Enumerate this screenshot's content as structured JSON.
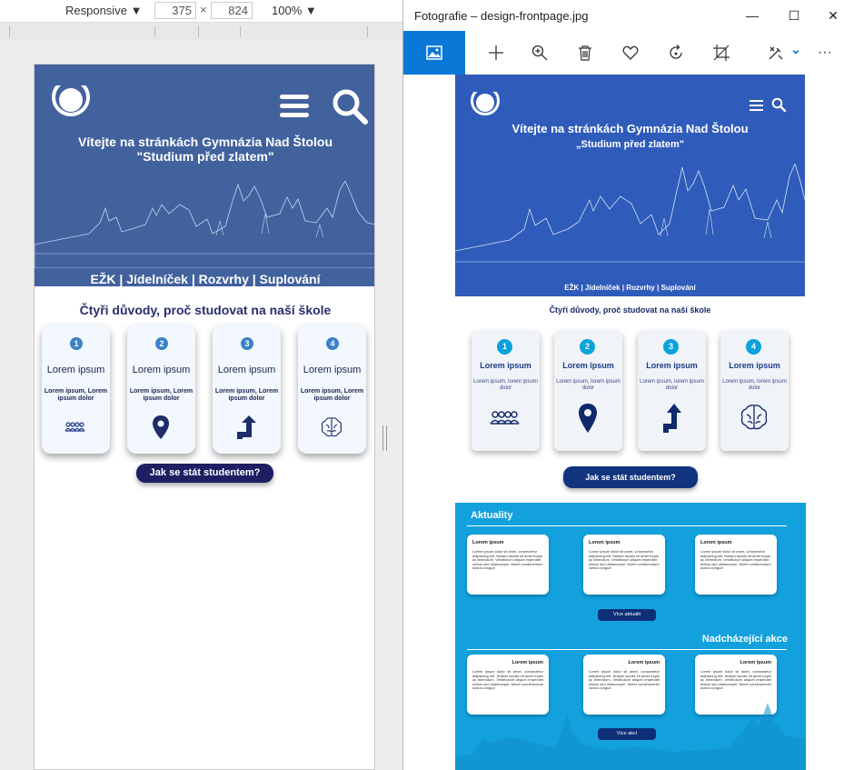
{
  "devtools": {
    "device": "Responsive",
    "width": "375",
    "times": "×",
    "height": "824",
    "zoom": "100%"
  },
  "left_site": {
    "welcome": "Vítejte na stránkách Gymnázia Nad Štolou",
    "motto": "\"Studium před zlatem\"",
    "links": "EŽK | Jídelníček | Rozvrhy | Suplování",
    "reasons_title": "Čtyři důvody, proč studovat na naší škole",
    "cards": [
      {
        "num": "1",
        "title": "Lorem ipsum",
        "desc": "Lorem ipsum, Lorem ipsum dolor"
      },
      {
        "num": "2",
        "title": "Lorem ipsum",
        "desc": "Lorem ipsum, Lorem ipsum dolor"
      },
      {
        "num": "3",
        "title": "Lorem ipsum",
        "desc": "Lorem ipsum, Lorem ipsum dolor"
      },
      {
        "num": "4",
        "title": "Lorem ipsum",
        "desc": "Lorem ipsum, Lorem ipsum dolor"
      }
    ],
    "cta": "Jak se stát studentem?"
  },
  "photos": {
    "title": "Fotografie – design-frontpage.jpg",
    "minimize": "—",
    "maximize": "☐",
    "close": "✕",
    "more": "···",
    "chevron": "⌄"
  },
  "right_site": {
    "welcome": "Vítejte na stránkách Gymnázia Nad Štolou",
    "motto": "„Studium před zlatem\"",
    "links": "EŽK | Jídelníček | Rozvrhy | Suplování",
    "reasons_title": "Čtyři důvody, proč studovat na naší škole",
    "cards": [
      {
        "num": "1",
        "title": "Lorem ipsum",
        "desc": "Lorem ipsum, lorem ipsum dolor"
      },
      {
        "num": "2",
        "title": "Lorem ipsum",
        "desc": "Lorem ipsum, lorem ipsum dolor"
      },
      {
        "num": "3",
        "title": "Lorem ipsum",
        "desc": "Lorem ipsum, lorem ipsum dolor"
      },
      {
        "num": "4",
        "title": "Lorem ipsum",
        "desc": "Lorem ipsum, lorem ipsum dolor"
      }
    ],
    "cta": "Jak se stát studentem?",
    "news_title": "Aktuality",
    "news": [
      {
        "title": "Lorem ipsum",
        "body": "Lorem ipsum dolor sit amet, consectetur adipiscing elit. Nullam iaculis sit amet turpis ac bibendum. Vestibulum aliquet imperdiet metus sed ullamcorper. Morbi condimentum luctus congue."
      },
      {
        "title": "Lorem ipsum",
        "body": "Lorem ipsum dolor sit amet, consectetur adipiscing elit. Nullam iaculis sit amet turpis ac bibendum. Vestibulum aliquet imperdiet metus sed ullamcorper. Morbi condimentum luctus congue."
      },
      {
        "title": "Lorem ipsum",
        "body": "Lorem ipsum dolor sit amet, consectetur adipiscing elit. Nullam iaculis sit amet turpis ac bibendum. Vestibulum aliquet imperdiet metus sed ullamcorper. Morbi condimentum luctus congue."
      }
    ],
    "news_button": "Více aktualit",
    "events_title": "Nadcházející akce",
    "events": [
      {
        "title": "Lorem ipsum",
        "body": "Lorem ipsum dolor sit amet, consectetur adipiscing elit. Nullam iaculis sit amet turpis ac bibendum. Vestibulum aliquet imperdiet metus sed ullamcorper. Morbi condimentum luctus congue."
      },
      {
        "title": "Lorem ipsum",
        "body": "Lorem ipsum dolor sit amet, consectetur adipiscing elit. Nullam iaculis sit amet turpis ac bibendum. Vestibulum aliquet imperdiet metus sed ullamcorper. Morbi condimentum luctus congue."
      },
      {
        "title": "Lorem ipsum",
        "body": "Lorem ipsum dolor sit amet, consectetur adipiscing elit. Nullam iaculis sit amet turpis ac bibendum. Vestibulum aliquet imperdiet metus sed ullamcorper. Morbi condimentum luctus congue."
      }
    ],
    "events_button": "Více akcí"
  },
  "colors": {
    "left_hero": "#42629e",
    "right_hero": "#2f5cba",
    "right_section": "#13a1de",
    "photos_accent": "#0a78d7",
    "dark_button": "#1e1f62"
  }
}
